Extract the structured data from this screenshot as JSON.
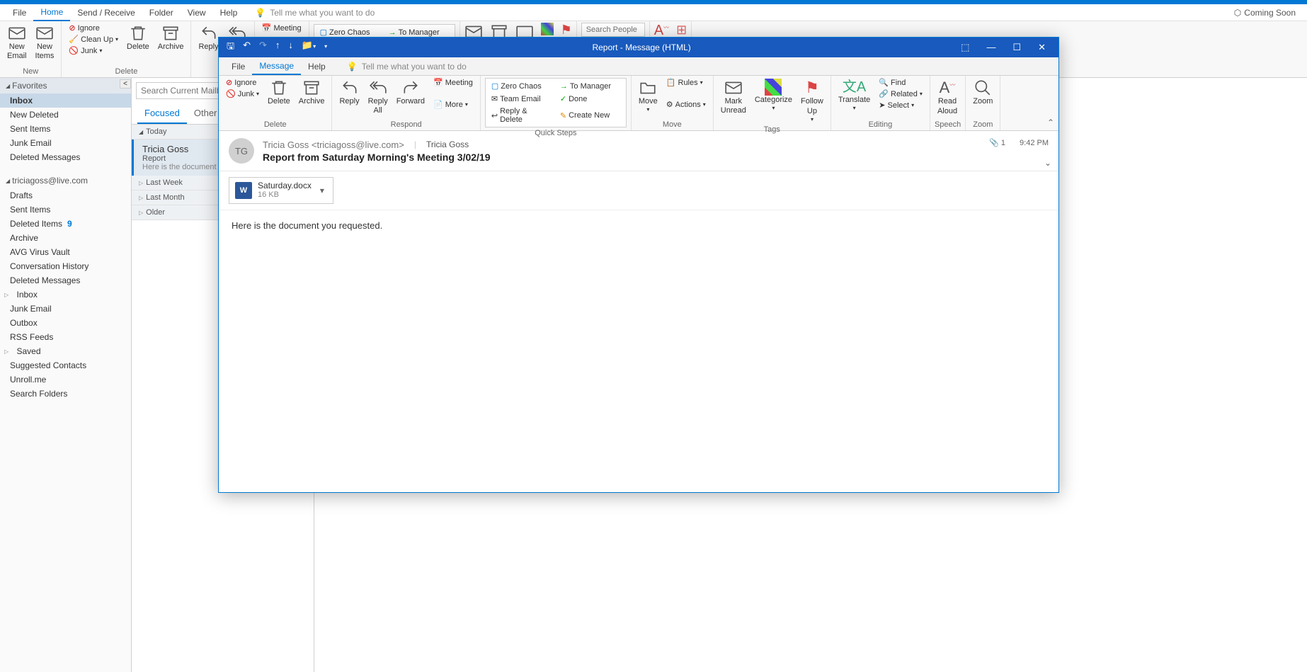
{
  "main_menu": {
    "items": [
      "File",
      "Home",
      "Send / Receive",
      "Folder",
      "View",
      "Help"
    ],
    "active": "Home",
    "tell_me": "Tell me what you want to do",
    "coming_soon": "Coming Soon"
  },
  "main_ribbon": {
    "new": {
      "label": "New",
      "email": "New\nEmail",
      "items": "New\nItems"
    },
    "delete": {
      "label": "Delete",
      "ignore": "Ignore",
      "cleanup": "Clean Up",
      "junk": "Junk",
      "delete": "Delete",
      "archive": "Archive"
    },
    "respond": {
      "reply": "Reply",
      "reply_all": "Reply\nAll",
      "meeting": "Meeting"
    },
    "quicksteps": {
      "zero_chaos": "Zero Chaos",
      "to_manager": "To Manager"
    },
    "search_people": "Search People"
  },
  "folders": {
    "favorites": "Favorites",
    "fav_items": [
      "Inbox",
      "New Deleted",
      "Sent Items",
      "Junk Email",
      "Deleted Messages"
    ],
    "account": "triciagoss@live.com",
    "acct_items": [
      {
        "name": "Drafts"
      },
      {
        "name": "Sent Items"
      },
      {
        "name": "Deleted Items",
        "count": "9"
      },
      {
        "name": "Archive"
      },
      {
        "name": "AVG Virus Vault"
      },
      {
        "name": "Conversation History"
      },
      {
        "name": "Deleted Messages"
      },
      {
        "name": "Inbox",
        "expandable": true
      },
      {
        "name": "Junk Email"
      },
      {
        "name": "Outbox"
      },
      {
        "name": "RSS Feeds"
      },
      {
        "name": "Saved",
        "expandable": true
      },
      {
        "name": "Suggested Contacts"
      },
      {
        "name": "Unroll.me"
      },
      {
        "name": "Search Folders"
      }
    ]
  },
  "message_list": {
    "search_placeholder": "Search Current Mailbox",
    "tabs": {
      "focused": "Focused",
      "other": "Other"
    },
    "groups": [
      {
        "header": "Today",
        "messages": [
          {
            "from": "Tricia Goss",
            "subject": "Report",
            "preview": "Here is the document"
          }
        ]
      },
      {
        "header": "Last Week"
      },
      {
        "header": "Last Month"
      },
      {
        "header": "Older"
      }
    ]
  },
  "msg_window": {
    "title": "Report  -  Message (HTML)",
    "menu": {
      "items": [
        "File",
        "Message",
        "Help"
      ],
      "active": "Message",
      "tell_me": "Tell me what you want to do"
    },
    "ribbon": {
      "delete": {
        "label": "Delete",
        "ignore": "Ignore",
        "junk": "Junk",
        "delete": "Delete",
        "archive": "Archive"
      },
      "respond": {
        "label": "Respond",
        "reply": "Reply",
        "reply_all": "Reply\nAll",
        "forward": "Forward",
        "meeting": "Meeting",
        "more": "More"
      },
      "quicksteps": {
        "label": "Quick Steps",
        "zero_chaos": "Zero Chaos",
        "team_email": "Team Email",
        "reply_delete": "Reply & Delete",
        "to_manager": "To Manager",
        "done": "Done",
        "create_new": "Create New"
      },
      "move": {
        "label": "Move",
        "move": "Move",
        "rules": "Rules",
        "actions": "Actions"
      },
      "tags": {
        "label": "Tags",
        "mark_unread": "Mark\nUnread",
        "categorize": "Categorize",
        "follow_up": "Follow\nUp"
      },
      "editing": {
        "label": "Editing",
        "translate": "Translate",
        "find": "Find",
        "related": "Related",
        "select": "Select"
      },
      "speech": {
        "label": "Speech",
        "read_aloud": "Read\nAloud"
      },
      "zoom": {
        "label": "Zoom",
        "zoom": "Zoom"
      }
    },
    "header": {
      "avatar": "TG",
      "sender": "Tricia Goss <triciagoss@live.com>",
      "recipient": "Tricia Goss",
      "subject": "Report from Saturday Morning's Meeting 3/02/19",
      "attach_count": "1",
      "time": "9:42 PM"
    },
    "attachment": {
      "name": "Saturday.docx",
      "size": "16 KB"
    },
    "body": "Here is the document you requested."
  }
}
